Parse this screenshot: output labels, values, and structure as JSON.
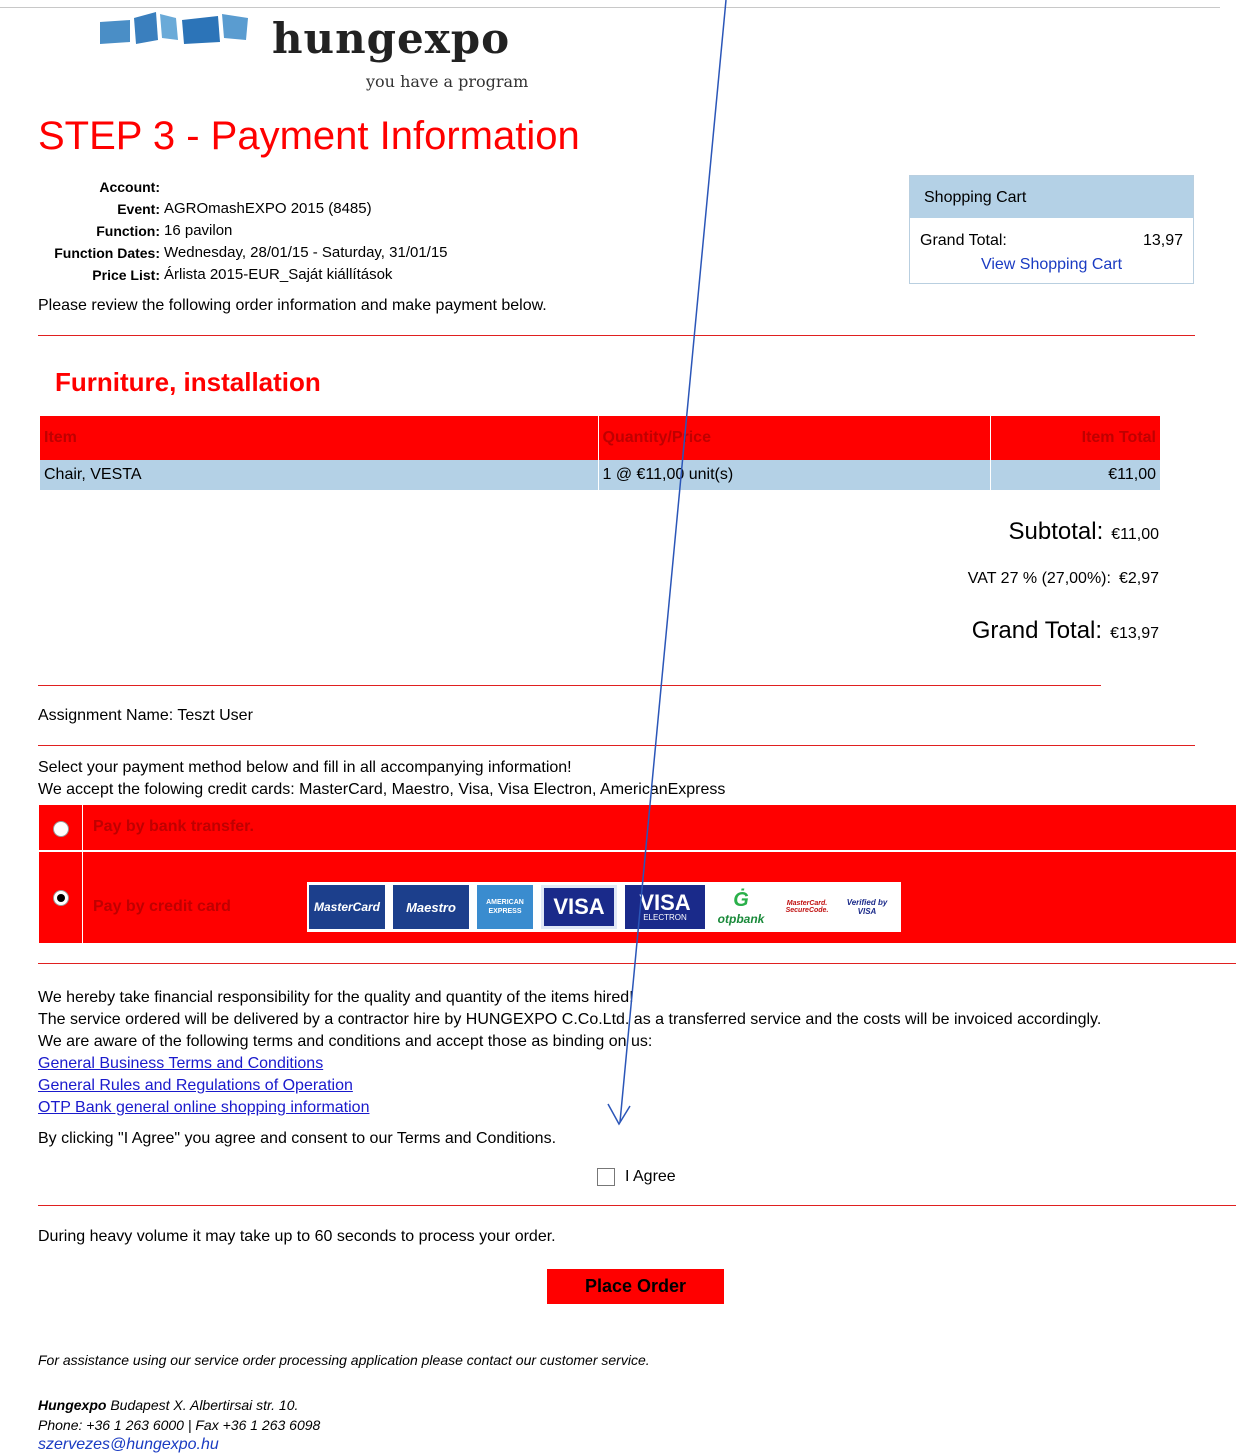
{
  "brand": {
    "name": "hungexpo",
    "tagline": "you have a program"
  },
  "page_title": "STEP 3 - Payment Information",
  "info": [
    {
      "label": "Account:",
      "value": ""
    },
    {
      "label": "Event:",
      "value": "AGROmashEXPO 2015 (8485)"
    },
    {
      "label": "Function:",
      "value": "16 pavilon"
    },
    {
      "label": "Function Dates:",
      "value": "Wednesday, 28/01/15 - Saturday, 31/01/15"
    },
    {
      "label": "Price List:",
      "value": "Árlista 2015-EUR_Saját kiállítások"
    }
  ],
  "review_text": "Please review the following order information and make payment below.",
  "cart": {
    "title": "Shopping Cart",
    "total_label": "Grand Total:",
    "total_value": "13,97",
    "link": "View Shopping Cart"
  },
  "section": "Furniture, installation",
  "table": {
    "headers": [
      "Item",
      "Quantity/Price",
      "Item Total"
    ],
    "rows": [
      [
        "Chair, VESTA",
        "1 @ €11,00 unit(s)",
        "€11,00"
      ]
    ]
  },
  "totals": {
    "subtotal_label": "Subtotal:",
    "subtotal": "€11,00",
    "vat_label": "VAT 27 % (27,00%):",
    "vat": "€2,97",
    "grand_label": "Grand Total:",
    "grand": "€13,97"
  },
  "assignment": "Assignment Name: Teszt User",
  "payment_intro": {
    "line1": "Select your payment method below and fill in all accompanying information!",
    "line2": "We accept the folowing credit cards: MasterCard, Maestro, Visa, Visa Electron, AmericanExpress"
  },
  "payment_options": [
    {
      "label": "Pay by bank transfer.",
      "selected": false
    },
    {
      "label": "Pay by credit card",
      "selected": true
    }
  ],
  "cards": [
    "MasterCard",
    "Maestro",
    "AMERICAN EXPRESS",
    "VISA",
    "VISA",
    "ELECTRON",
    "otpbank",
    "MasterCard. SecureCode.",
    "Verified by VISA"
  ],
  "terms": {
    "line1": "We hereby take financial responsibility for the quality and quantity of the items hired!",
    "line2": "The service ordered will be delivered by a contractor hire by HUNGEXPO C.Co.Ltd. as a transferred service and the costs will be invoiced accordingly.",
    "line3": "We are aware of the following terms and conditions and accept those as binding on us:",
    "links": [
      "General Business Terms and Conditions",
      "General Rules and Regulations of Operation",
      "OTP Bank general online shopping information"
    ]
  },
  "consent": "By clicking \"I Agree\" you agree and consent to our Terms and Conditions.",
  "agree_label": "I Agree",
  "volume_note": "During heavy volume it may take up to 60 seconds to process your order.",
  "place_order": "Place Order",
  "assistance": "For assistance using our service order processing application please contact our customer service.",
  "footer": {
    "company": "Hungexpo",
    "address": " Budapest X. Albertirsai str. 10.",
    "phone": "Phone: +36 1 263 6000 | Fax +36 1 263 6098",
    "email": "szervezes@hungexpo.hu"
  },
  "colors": {
    "accent": "#ff0000",
    "cart_blue": "#b4d1e6",
    "link": "#1a1acc",
    "arrow": "#2b56b8"
  }
}
